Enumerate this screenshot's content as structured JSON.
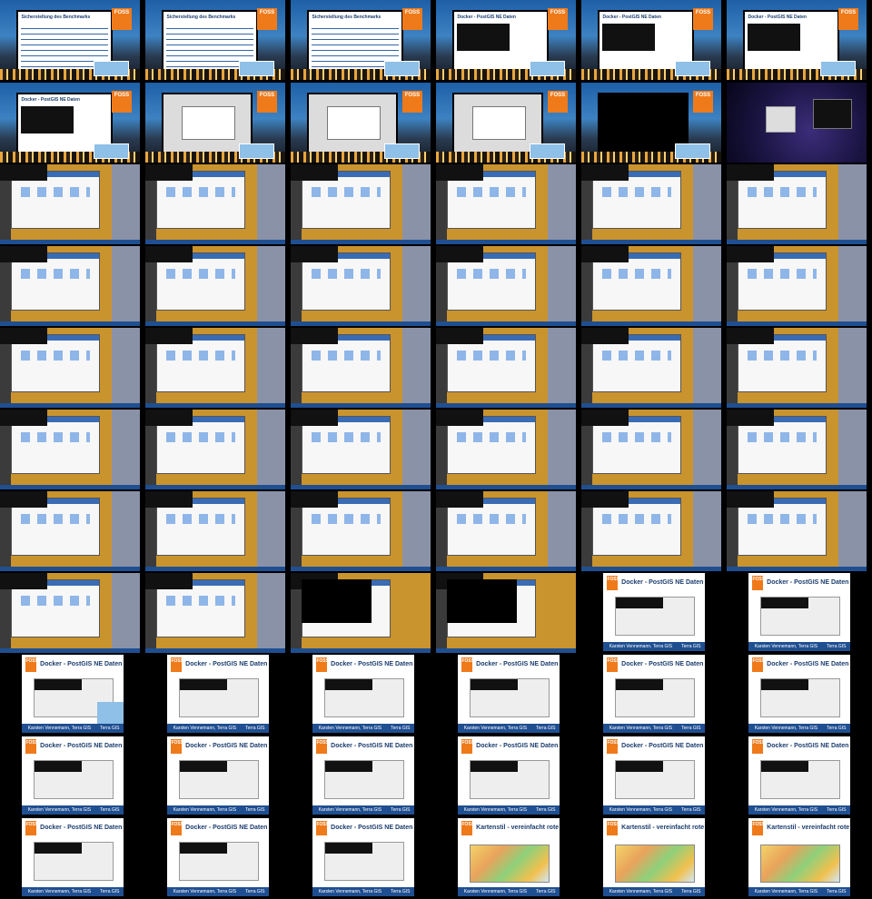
{
  "grid": {
    "rows": [
      [
        "stage-text",
        "stage-text",
        "stage-text",
        "stage-docker",
        "stage-docker",
        "stage-docker"
      ],
      [
        "stage-docker",
        "stage-win",
        "stage-win",
        "stage-win",
        "stage-dark",
        "space"
      ],
      [
        "desktop",
        "desktop",
        "desktop",
        "desktop",
        "desktop",
        "desktop"
      ],
      [
        "desktop",
        "desktop",
        "desktop",
        "desktop",
        "desktop",
        "desktop"
      ],
      [
        "desktop",
        "desktop",
        "desktop",
        "desktop",
        "desktop",
        "desktop"
      ],
      [
        "desktop",
        "desktop",
        "desktop",
        "desktop",
        "desktop",
        "desktop"
      ],
      [
        "desktop",
        "desktop",
        "desktop",
        "desktop",
        "desktop",
        "desktop"
      ],
      [
        "desktop",
        "desktop",
        "dark",
        "dark",
        "slide-docker",
        "slide-docker"
      ],
      [
        "slide-docker",
        "slide-docker",
        "slide-docker",
        "slide-docker",
        "slide-docker",
        "slide-docker"
      ],
      [
        "slide-docker",
        "slide-docker",
        "slide-docker",
        "slide-docker",
        "slide-docker",
        "slide-docker"
      ],
      [
        "slide-docker",
        "slide-docker",
        "slide-docker",
        "slide-map",
        "slide-map",
        "slide-map"
      ]
    ]
  },
  "slides": {
    "stage_text_title": "Sicherstellung des Benchmarks",
    "docker_title": "Docker - PostGIS NE Daten",
    "map_title": "Kartenstil - vereinfacht rote",
    "footer_text": "Karsten Vennemann, Terra GIS",
    "brand": "Terra GIS",
    "conference_logo": "FOSS"
  },
  "colors": {
    "background": "#000000",
    "accent_orange": "#ef7a1a",
    "footer_blue": "#1f4f91",
    "desktop_gold": "#c9932e"
  }
}
